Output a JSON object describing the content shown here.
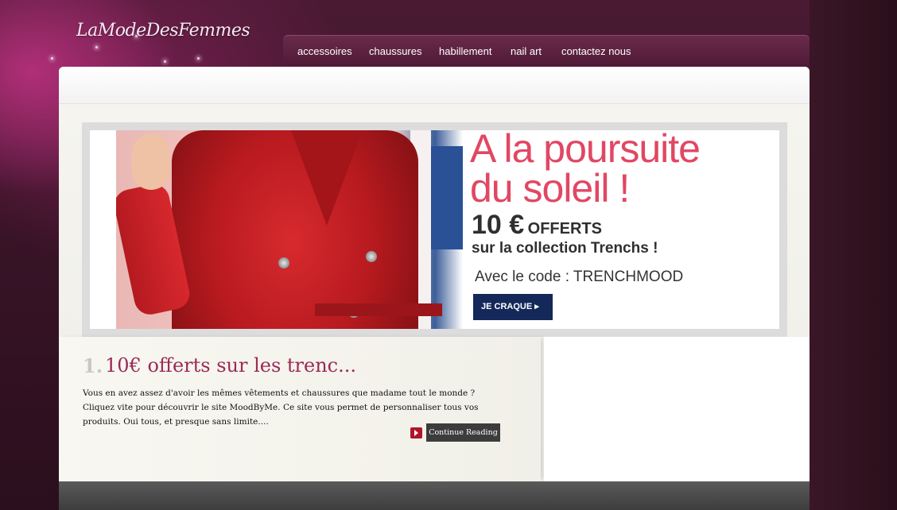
{
  "site": {
    "logo": "LaModeDesFemmes"
  },
  "nav": {
    "items": [
      {
        "label": "accessoires"
      },
      {
        "label": "chaussures"
      },
      {
        "label": "habillement"
      },
      {
        "label": "nail art"
      },
      {
        "label": "contactez nous"
      }
    ]
  },
  "banner": {
    "headline_line1": "A la poursuite",
    "headline_line2": "du soleil !",
    "offer_amount": "10 €",
    "offer_word": "OFFERTS",
    "offer_line2": "sur la collection Trenchs !",
    "code_text": "Avec le code : TRENCHMOOD",
    "cta_label": "JE CRAQUE ▸"
  },
  "post": {
    "number": "1.",
    "title": "10€ offerts sur les trenc...",
    "excerpt": "Vous en avez assez d'avoir les mêmes vêtements et chaussures que madame tout le monde ? Cliquez vite pour découvrir le site MoodByMe. Ce site vous permet de personnaliser tous vos produits. Oui tous, et presque sans limite....",
    "read_more": "Continue Reading"
  },
  "colors": {
    "accent": "#9a2a57",
    "nav_bg": "#5a2040",
    "cta_bg": "#14295a",
    "headline": "#e14763"
  }
}
